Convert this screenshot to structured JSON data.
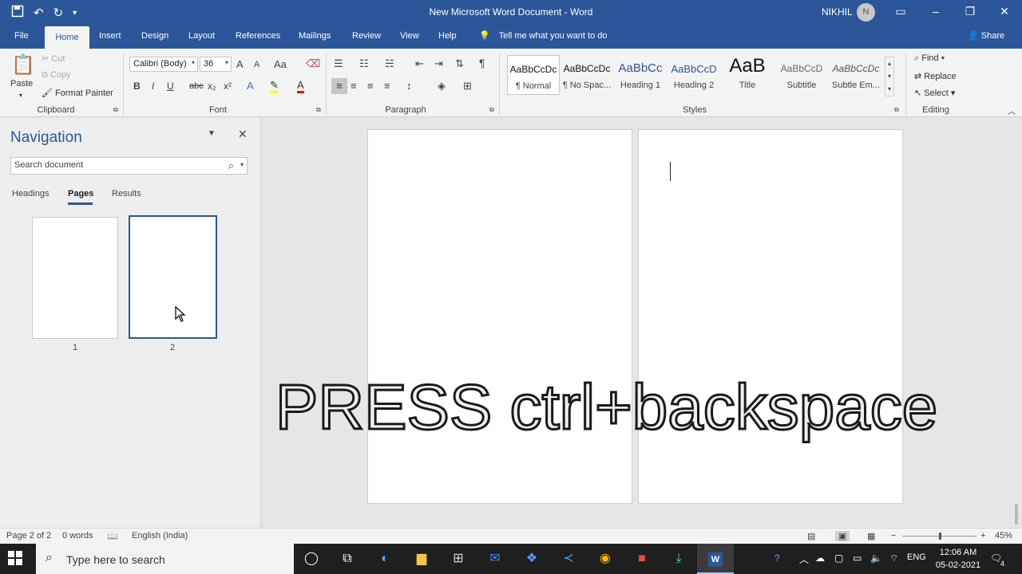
{
  "titlebar": {
    "title": "New Microsoft Word Document  -  Word",
    "user": "NIKHIL",
    "avatar": "N",
    "qat": {
      "save_icon": "floppy-disk",
      "undo_icon": "undo-arrow",
      "redo_icon": "repeat-arrow",
      "customize_icon": "chevron-down"
    },
    "window_buttons": {
      "ribbon_display": "▭",
      "minimize": "–",
      "restore": "❐",
      "close": "✕"
    }
  },
  "tabs": {
    "file": "File",
    "items": [
      "Home",
      "Insert",
      "Design",
      "Layout",
      "References",
      "Mailings",
      "Review",
      "View",
      "Help"
    ],
    "active": "Home",
    "tell_me": "Tell me what you want to do",
    "share": "Share"
  },
  "ribbon": {
    "clipboard": {
      "label": "Clipboard",
      "paste": "Paste",
      "cut": "Cut",
      "copy": "Copy",
      "format_painter": "Format Painter"
    },
    "font": {
      "label": "Font",
      "name": "Calibri (Body)",
      "size": "36",
      "bold": "B",
      "italic": "I",
      "underline": "U",
      "strike": "abc",
      "subscript": "x₂",
      "superscript": "x²",
      "change_case": "Aa",
      "grow": "A",
      "shrink": "A"
    },
    "paragraph": {
      "label": "Paragraph",
      "pilcrow": "¶"
    },
    "styles": {
      "label": "Styles",
      "items": [
        {
          "preview": "AaBbCcDc",
          "name": "¶ Normal"
        },
        {
          "preview": "AaBbCcDc",
          "name": "¶ No Spac..."
        },
        {
          "preview": "AaBbCc",
          "name": "Heading 1"
        },
        {
          "preview": "AaBbCcD",
          "name": "Heading 2"
        },
        {
          "preview": "AaB",
          "name": "Title"
        },
        {
          "preview": "AaBbCcD",
          "name": "Subtitle"
        },
        {
          "preview": "AaBbCcDc",
          "name": "Subtle Em..."
        }
      ]
    },
    "editing": {
      "label": "Editing",
      "find": "Find",
      "replace": "Replace",
      "select": "Select"
    }
  },
  "navigation": {
    "title": "Navigation",
    "search_placeholder": "Search document",
    "tabs": [
      "Headings",
      "Pages",
      "Results"
    ],
    "active_tab": "Pages",
    "pages": [
      "1",
      "2"
    ]
  },
  "overlay_text": "PRESS ctrl+backspace",
  "status": {
    "page": "Page 2 of 2",
    "words": "0 words",
    "language": "English (India)",
    "zoom": "45%"
  },
  "taskbar": {
    "search_placeholder": "Type here to search",
    "lang": "ENG",
    "time": "12:06 AM",
    "date": "05-02-2021",
    "notifications": "4"
  }
}
